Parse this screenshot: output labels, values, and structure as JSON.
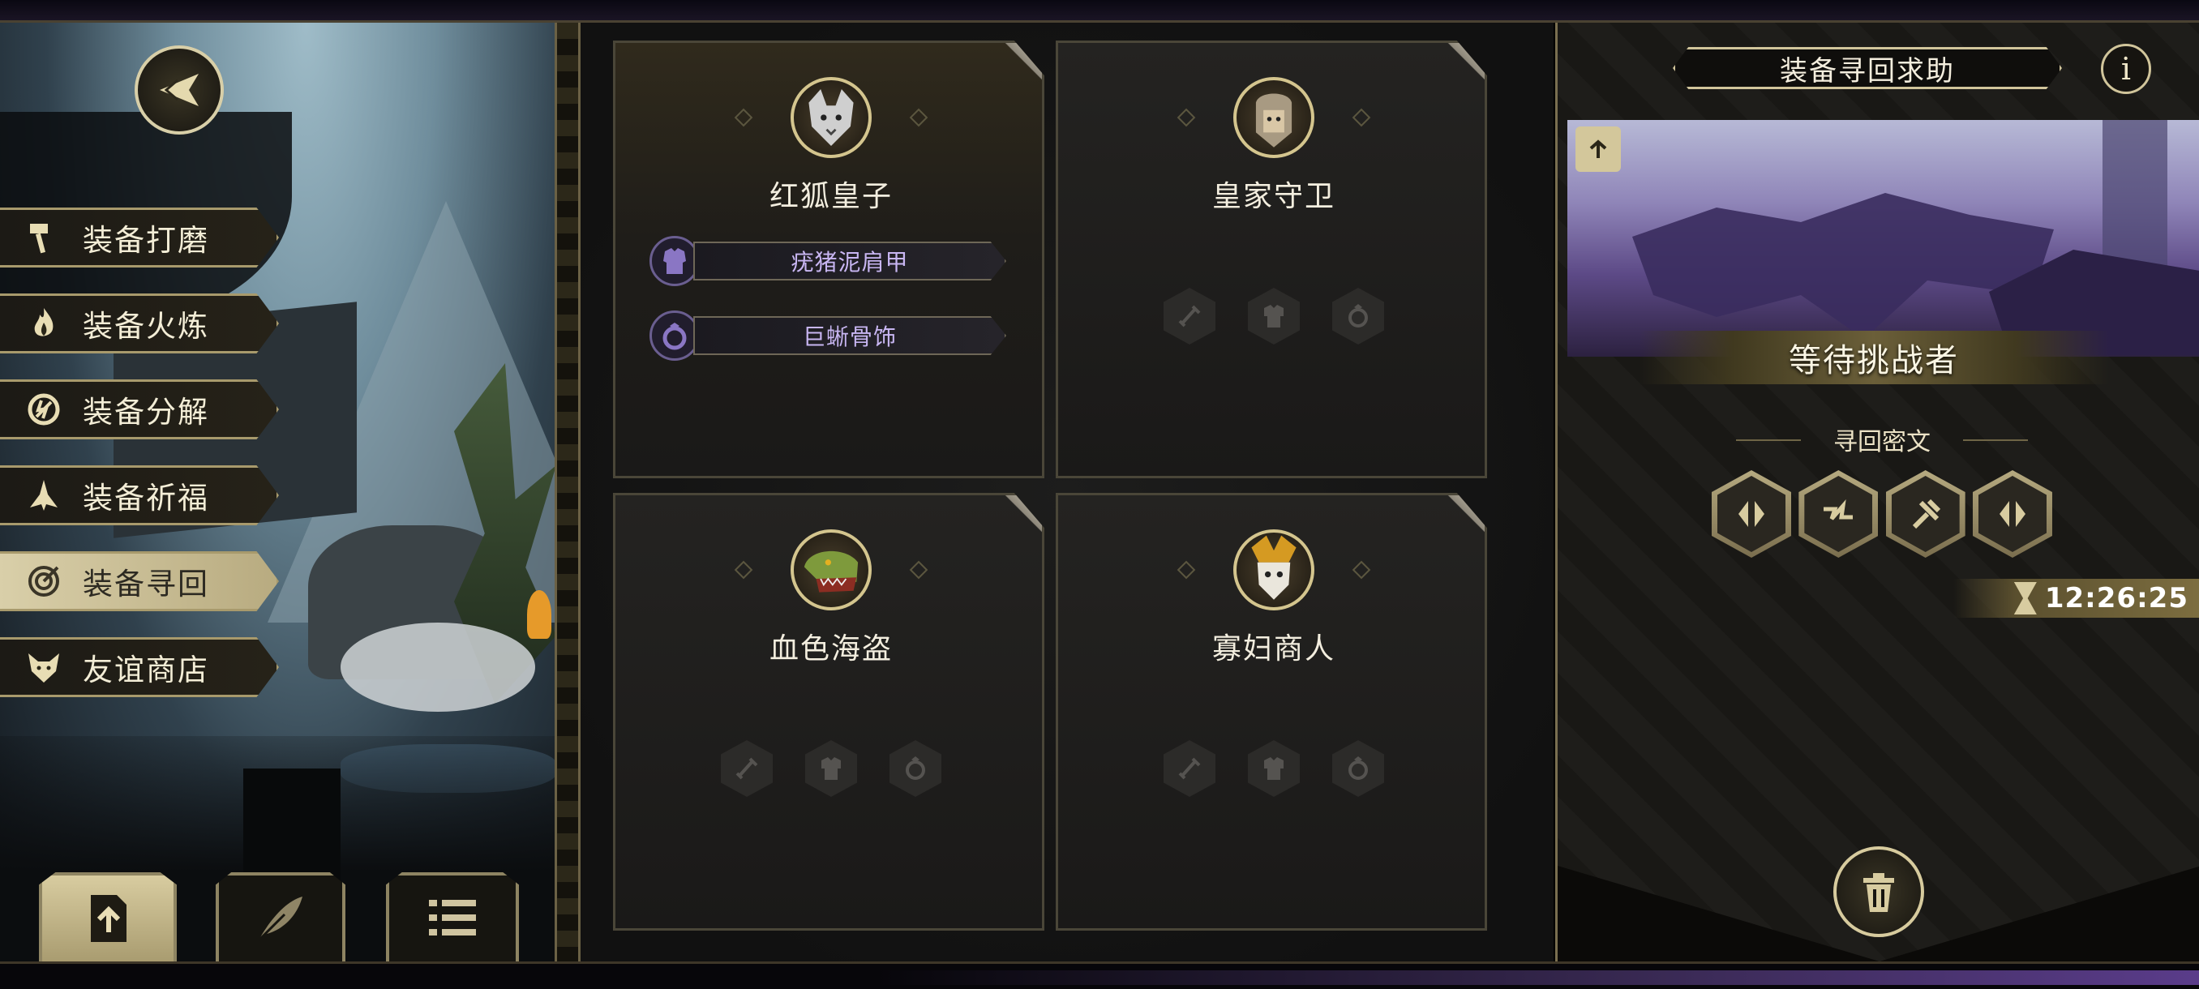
{
  "colors": {
    "gold": "#d8cca0",
    "purple_text": "#c8b6f2",
    "panel_bg": "#1a1918"
  },
  "nav": {
    "back_icon": "back-arrow-icon",
    "menu": [
      {
        "label": "装备打磨",
        "icon": "hammer-icon",
        "active": false
      },
      {
        "label": "装备火炼",
        "icon": "flame-icon",
        "active": false
      },
      {
        "label": "装备分解",
        "icon": "decompose-icon",
        "active": false
      },
      {
        "label": "装备祈福",
        "icon": "pray-icon",
        "active": false
      },
      {
        "label": "装备寻回",
        "icon": "retrieve-icon",
        "active": true
      },
      {
        "label": "友谊商店",
        "icon": "fox-icon",
        "active": false
      }
    ],
    "tabs": [
      {
        "icon": "upload-icon",
        "active": true
      },
      {
        "icon": "feather-icon",
        "active": false
      },
      {
        "icon": "list-icon",
        "active": false
      }
    ]
  },
  "characters": [
    {
      "name": "红狐皇子",
      "equipment": [
        {
          "name": "疣猪泥肩甲",
          "icon": "armor-icon"
        },
        {
          "name": "巨蜥骨饰",
          "icon": "ring-icon"
        }
      ]
    },
    {
      "name": "皇家守卫",
      "equipment": []
    },
    {
      "name": "血色海盗",
      "equipment": []
    },
    {
      "name": "寡妇商人",
      "equipment": []
    }
  ],
  "panel": {
    "title": "装备寻回求助",
    "info_label": "i",
    "status": "等待挑战者",
    "rune_title": "寻回密文",
    "runes": [
      "rune-split-icon",
      "rune-zigzag-icon",
      "rune-hook-icon",
      "rune-split-icon"
    ],
    "timer": "12:26:25",
    "delete_icon": "trash-icon"
  }
}
